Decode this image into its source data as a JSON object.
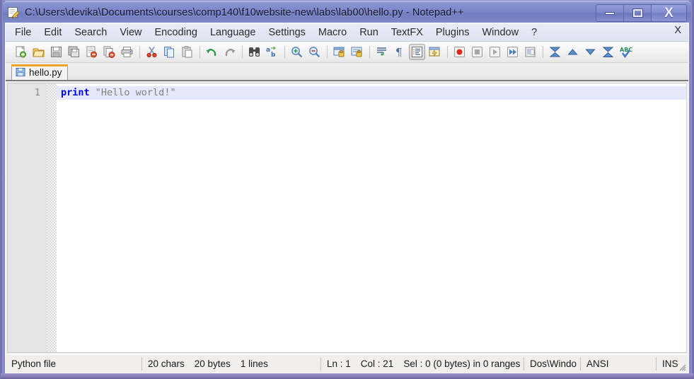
{
  "window": {
    "title": "C:\\Users\\devika\\Documents\\courses\\comp140\\f10website-new\\labs\\lab00\\hello.py - Notepad++",
    "app_icon": "notepad-plus-plus-icon",
    "controls": {
      "minimize": "minimize-icon",
      "maximize": "maximize-icon",
      "close": "X"
    },
    "accent_title_bar": "#7b87c9",
    "frame_color": "#8089c9"
  },
  "menubar": {
    "items": [
      {
        "label": "File"
      },
      {
        "label": "Edit"
      },
      {
        "label": "Search"
      },
      {
        "label": "View"
      },
      {
        "label": "Encoding"
      },
      {
        "label": "Language"
      },
      {
        "label": "Settings"
      },
      {
        "label": "Macro"
      },
      {
        "label": "Run"
      },
      {
        "label": "TextFX"
      },
      {
        "label": "Plugins"
      },
      {
        "label": "Window"
      },
      {
        "label": "?"
      }
    ],
    "close_document_label": "X"
  },
  "toolbar": {
    "buttons": [
      {
        "name": "new-file-icon",
        "sep": false,
        "pressed": false
      },
      {
        "name": "open-file-icon",
        "sep": false,
        "pressed": false
      },
      {
        "name": "save-icon",
        "sep": false,
        "pressed": false
      },
      {
        "name": "save-all-icon",
        "sep": false,
        "pressed": false
      },
      {
        "name": "close-file-icon",
        "sep": false,
        "pressed": false
      },
      {
        "name": "close-all-files-icon",
        "sep": false,
        "pressed": false
      },
      {
        "name": "print-icon",
        "sep": true,
        "pressed": false
      },
      {
        "name": "cut-icon",
        "sep": false,
        "pressed": false
      },
      {
        "name": "copy-icon",
        "sep": false,
        "pressed": false
      },
      {
        "name": "paste-icon",
        "sep": true,
        "pressed": false
      },
      {
        "name": "undo-icon",
        "sep": false,
        "pressed": false
      },
      {
        "name": "redo-icon",
        "sep": true,
        "pressed": false
      },
      {
        "name": "find-icon",
        "sep": false,
        "pressed": false
      },
      {
        "name": "replace-icon",
        "sep": true,
        "pressed": false
      },
      {
        "name": "zoom-in-icon",
        "sep": false,
        "pressed": false
      },
      {
        "name": "zoom-out-icon",
        "sep": true,
        "pressed": false
      },
      {
        "name": "sync-vertical-scrolling-icon",
        "sep": false,
        "pressed": false
      },
      {
        "name": "sync-horizontal-scrolling-icon",
        "sep": true,
        "pressed": false
      },
      {
        "name": "word-wrap-icon",
        "sep": false,
        "pressed": false
      },
      {
        "name": "show-all-characters-icon",
        "sep": false,
        "pressed": false
      },
      {
        "name": "indent-guide-icon",
        "sep": false,
        "pressed": true
      },
      {
        "name": "user-defined-dialog-icon",
        "sep": true,
        "pressed": false
      },
      {
        "name": "record-macro-icon",
        "sep": false,
        "pressed": false
      },
      {
        "name": "stop-macro-icon",
        "sep": false,
        "pressed": false
      },
      {
        "name": "play-macro-icon",
        "sep": false,
        "pressed": false
      },
      {
        "name": "run-macro-multiple-icon",
        "sep": false,
        "pressed": false
      },
      {
        "name": "save-macro-icon",
        "sep": true,
        "pressed": false
      },
      {
        "name": "collapse-all-icon",
        "sep": false,
        "pressed": false
      },
      {
        "name": "fold-up-icon",
        "sep": false,
        "pressed": false
      },
      {
        "name": "unfold-down-icon",
        "sep": false,
        "pressed": false
      },
      {
        "name": "expand-all-icon",
        "sep": false,
        "pressed": false
      },
      {
        "name": "spell-check-icon",
        "sep": false,
        "pressed": false
      }
    ]
  },
  "tabs": [
    {
      "label": "hello.py",
      "icon": "saved-file-icon",
      "active": true
    }
  ],
  "editor": {
    "lines": [
      {
        "number": "1",
        "current": true,
        "tokens": [
          {
            "text": "print",
            "type": "keyword"
          },
          {
            "text": " ",
            "type": "plain"
          },
          {
            "text": "\"Hello world!\"",
            "type": "string"
          }
        ]
      }
    ],
    "keyword_color": "#0000ff",
    "string_color": "#808080",
    "current_line_color": "#e8e8fc"
  },
  "statusbar": {
    "file_type": "Python file",
    "chars": "20 chars",
    "bytes": "20 bytes",
    "lines": "1 lines",
    "ln": "Ln : 1",
    "col": "Col : 21",
    "sel": "Sel : 0 (0 bytes) in 0 ranges",
    "eol": "Dos\\Windo",
    "encoding": "ANSI",
    "insert_mode": "INS"
  }
}
